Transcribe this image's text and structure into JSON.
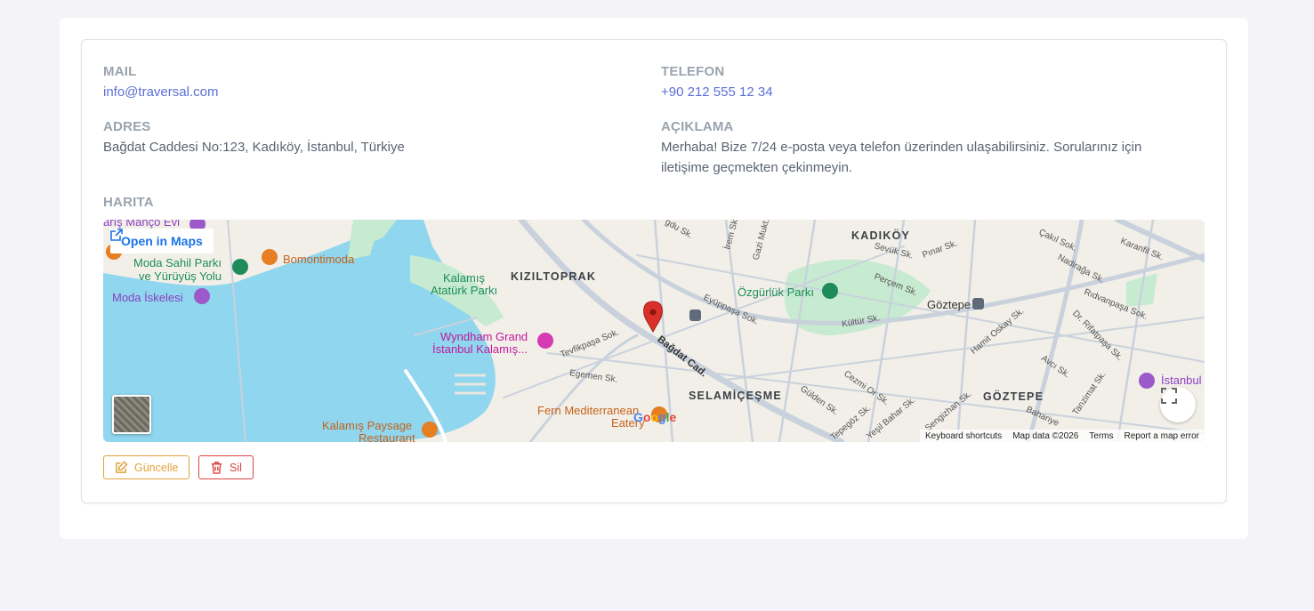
{
  "contact": {
    "mail_label": "MAIL",
    "mail_value": "info@traversal.com",
    "phone_label": "TELEFON",
    "phone_value": "+90 212 555 12 34",
    "address_label": "ADRES",
    "address_value": "Bağdat Caddesi No:123, Kadıköy, İstanbul, Türkiye",
    "description_label": "AÇIKLAMA",
    "description_value": "Merhaba! Bize 7/24 e-posta veya telefon üzerinden ulaşabilirsiniz. Sorularınız için iletişime geçmekten çekinmeyin.",
    "map_label": "HARITA"
  },
  "map": {
    "open_in_maps": "Open in Maps",
    "labels": {
      "kadikoy": "KADIKÖY",
      "kiziltoprak": "KIZILTOPRAK",
      "selamicesme": "SELAMİÇEŞME",
      "goztepe_district": "GÖZTEPE",
      "goztepe_station": "Göztepe",
      "ozgurluk_parki": "Özgürlük Parkı",
      "kalamis_parki_1": "Kalamış",
      "kalamis_parki_2": "Atatürk Parkı",
      "moda_sahil_1": "Moda Sahil Parkı",
      "moda_sahil_2": "ve Yürüyüş Yolu",
      "moda_iskelesi": "Moda İskelesi",
      "bomontimoda": "Bomontimoda",
      "baris_manco": "arış Manço Evi",
      "wyndham_1": "Wyndham Grand",
      "wyndham_2": "İstanbul Kalamış...",
      "kalamis_paysage_1": "Kalamış Paysage",
      "kalamis_paysage_2": "Restaurant",
      "fern_1": "Fern Mediterranean",
      "fern_2": "Eatery",
      "istanbul_poi": "İstanbul",
      "bagdat_cad": "Bağdat Cad.",
      "tevfikpasa": "Tevfikpaşa Sok.",
      "egemen": "Egemen Sk.",
      "eyuppasa": "Eyüppaşa Sok.",
      "kultur": "Kültür Sk.",
      "percem": "Perçem Sk.",
      "sevuk": "Sevük Sk.",
      "pinar": "Pınar Sk.",
      "cakil": "Çakıl Sok.",
      "nadiraga": "Nadirağa Sk.",
      "karanfil": "Karanfil Sk.",
      "ridvanpasa": "Rıdvanpaşa Sok.",
      "rifatpasa": "Dr. Rifatpaşa Sk.",
      "hamit": "Hamit Oskay Sk.",
      "avci": "Avcı Sk.",
      "gulden": "Gülden Sk.",
      "cezmi": "Cezmi Or Sk.",
      "tepegoz": "Tepegöz Sk.",
      "yesilbahar": "Yeşil Bahar Sk.",
      "sengizhan": "Sengizhan Sk.",
      "irem": "İrem Sk.",
      "gazi": "Gazi Mukt...",
      "gdu": "gdu Sk.",
      "tanzimat": "Tanzimat Sk.",
      "bahariye": "Bahariye",
      "google": "Google"
    },
    "attribution": {
      "shortcuts": "Keyboard shortcuts",
      "data": "Map data ©2026",
      "terms": "Terms",
      "report": "Report a map error"
    },
    "colors": {
      "water": "#8fd6ee",
      "park": "#c6ebd0",
      "land": "#f2efe9",
      "road": "#ffffff",
      "marker": "#d9302a"
    }
  },
  "actions": {
    "update_label": "Güncelle",
    "delete_label": "Sil"
  }
}
